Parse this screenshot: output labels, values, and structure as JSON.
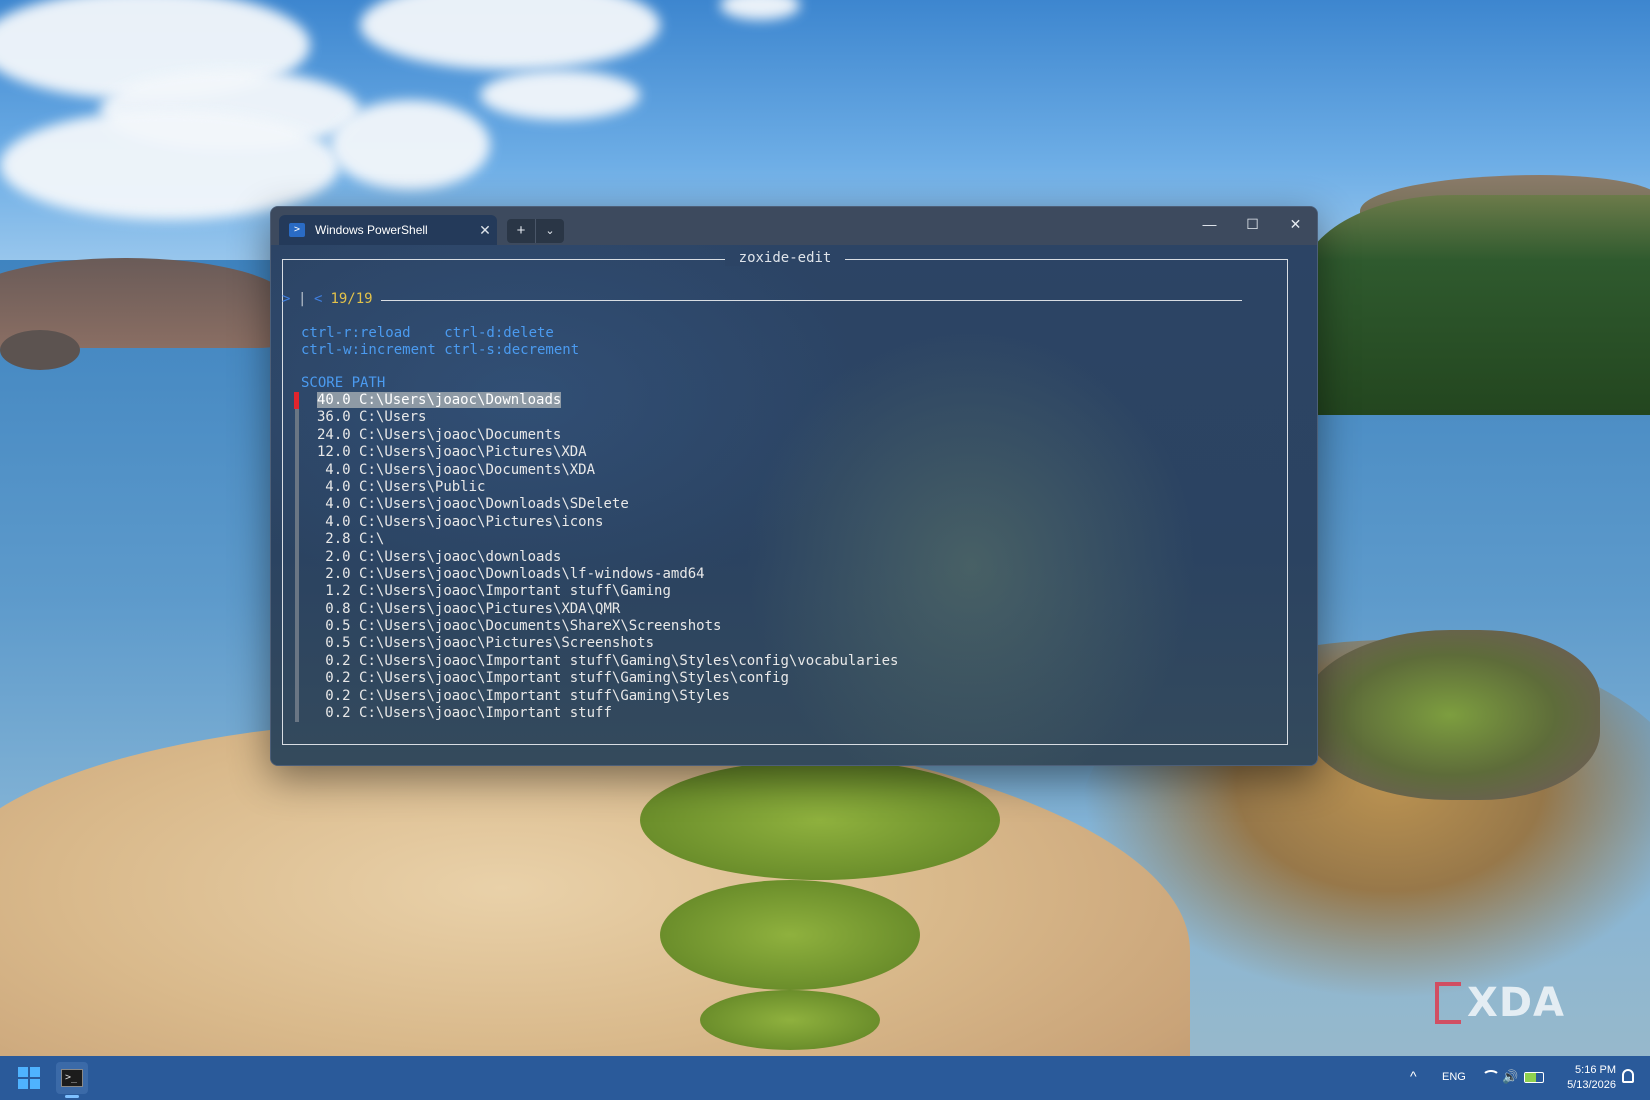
{
  "window": {
    "tab_title": "Windows PowerShell",
    "tab_close": "✕",
    "new_tab": "+",
    "dropdown": "⌄",
    "minimize": "—",
    "maximize": "☐",
    "close": "✕"
  },
  "terminal": {
    "frame_title": "zoxide-edit",
    "prompt": {
      "caret": ">",
      "cursor": "|",
      "lead": "<",
      "count": "19/19"
    },
    "help_lines": [
      "ctrl-r:reload    ctrl-d:delete",
      "ctrl-w:increment ctrl-s:decrement"
    ],
    "header": "SCORE PATH",
    "rows": [
      {
        "score": "40.0",
        "path": "C:\\Users\\joaoc\\Downloads"
      },
      {
        "score": "36.0",
        "path": "C:\\Users"
      },
      {
        "score": "24.0",
        "path": "C:\\Users\\joaoc\\Documents"
      },
      {
        "score": "12.0",
        "path": "C:\\Users\\joaoc\\Pictures\\XDA"
      },
      {
        "score": "4.0",
        "path": "C:\\Users\\joaoc\\Documents\\XDA"
      },
      {
        "score": "4.0",
        "path": "C:\\Users\\Public"
      },
      {
        "score": "4.0",
        "path": "C:\\Users\\joaoc\\Downloads\\SDelete"
      },
      {
        "score": "4.0",
        "path": "C:\\Users\\joaoc\\Pictures\\icons"
      },
      {
        "score": "2.8",
        "path": "C:\\"
      },
      {
        "score": "2.0",
        "path": "C:\\Users\\joaoc\\downloads"
      },
      {
        "score": "2.0",
        "path": "C:\\Users\\joaoc\\Downloads\\lf-windows-amd64"
      },
      {
        "score": "1.2",
        "path": "C:\\Users\\joaoc\\Important stuff\\Gaming"
      },
      {
        "score": "0.8",
        "path": "C:\\Users\\joaoc\\Pictures\\XDA\\QMR"
      },
      {
        "score": "0.5",
        "path": "C:\\Users\\joaoc\\Documents\\ShareX\\Screenshots"
      },
      {
        "score": "0.5",
        "path": "C:\\Users\\joaoc\\Pictures\\Screenshots"
      },
      {
        "score": "0.2",
        "path": "C:\\Users\\joaoc\\Important stuff\\Gaming\\Styles\\config\\vocabularies"
      },
      {
        "score": "0.2",
        "path": "C:\\Users\\joaoc\\Important stuff\\Gaming\\Styles\\config"
      },
      {
        "score": "0.2",
        "path": "C:\\Users\\joaoc\\Important stuff\\Gaming\\Styles"
      },
      {
        "score": "0.2",
        "path": "C:\\Users\\joaoc\\Important stuff"
      }
    ],
    "selected_index": 0
  },
  "taskbar": {
    "language": "ENG",
    "time": "5:16 PM",
    "date": "5/13/2026",
    "tray_chevron": "^",
    "icons": [
      "windows-start-icon",
      "terminal-icon",
      "chevron-up-icon",
      "wifi-icon",
      "volume-icon",
      "battery-icon",
      "notification-bell-icon"
    ]
  },
  "watermark": "XDA",
  "colors": {
    "accent_blue": "#4b9bf0",
    "count_yellow": "#e3c24a",
    "selection_red": "#e0242c",
    "taskbar": "#2a5a9a"
  }
}
